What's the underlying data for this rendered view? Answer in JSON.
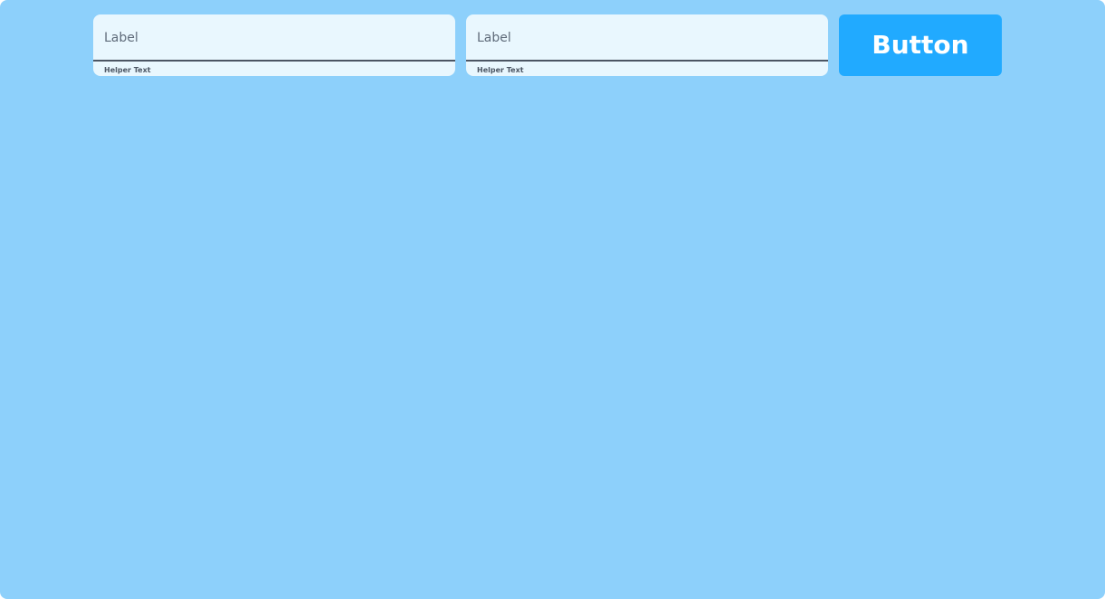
{
  "colors": {
    "background": "#8dd0fb",
    "field_fill": "#e9f7fe",
    "field_underline": "#4b5563",
    "button_fill": "#21aaff",
    "button_text": "#ffffff"
  },
  "form": {
    "fields": [
      {
        "placeholder": "Label",
        "helper": "Helper Text"
      },
      {
        "placeholder": "Label",
        "helper": "Helper Text"
      }
    ],
    "button_label": "Button"
  }
}
